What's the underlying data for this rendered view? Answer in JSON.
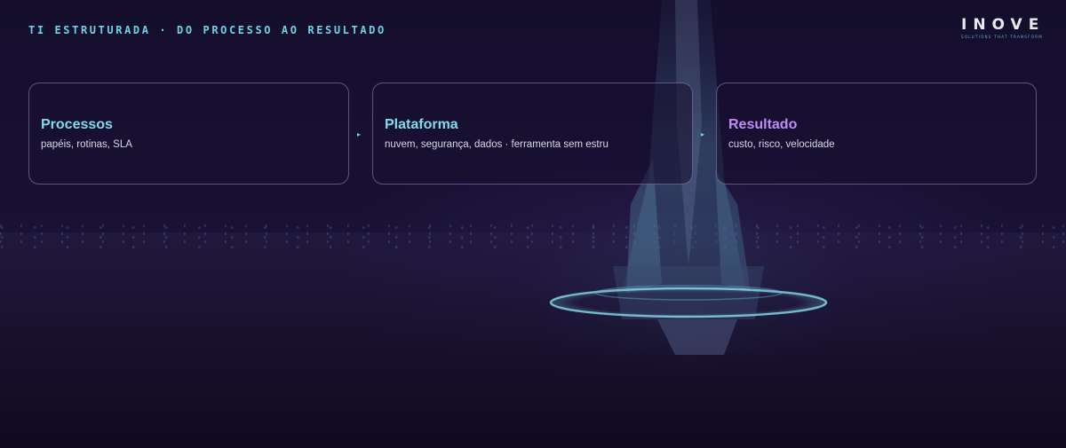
{
  "header": {
    "title": "TI ESTRUTURADA · DO PROCESSO AO RESULTADO"
  },
  "logo": {
    "wordmark": "INOVE",
    "tagline": "SOLUTIONS THAT TRANSFORM"
  },
  "flow": {
    "arrow_glyph": "▸",
    "steps": [
      {
        "title": "Processos",
        "subtitle": "papéis, rotinas, SLA",
        "accent": "#7fdcf0"
      },
      {
        "title": "Plataforma",
        "subtitle": "nuvem, segurança, dados · ferramenta sem estru",
        "accent": "#7fdcf0"
      },
      {
        "title": "Resultado",
        "subtitle": "custo, risco, velocidade",
        "accent": "#c08cf6"
      }
    ]
  },
  "colors": {
    "heading": "#6fd3e3",
    "background": "#140d2c",
    "card_border": "#8f86c4"
  }
}
